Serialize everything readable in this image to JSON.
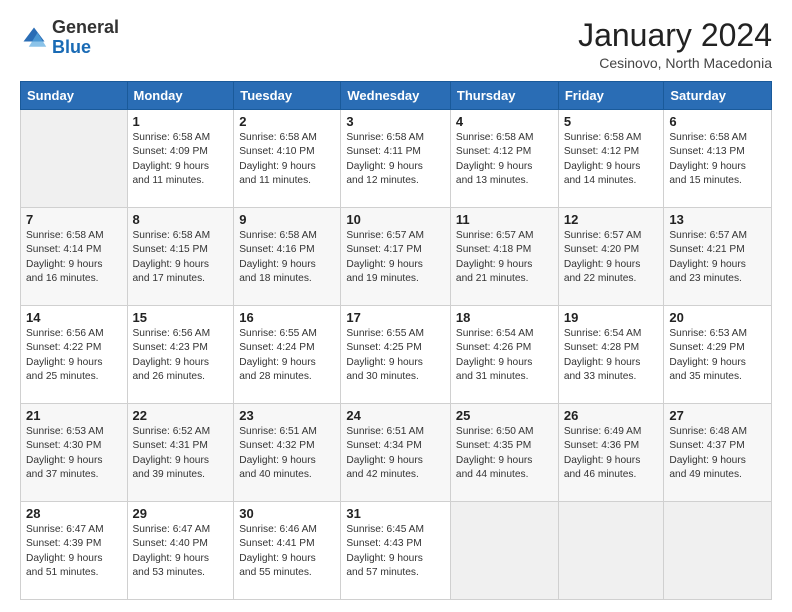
{
  "logo": {
    "general": "General",
    "blue": "Blue"
  },
  "header": {
    "month": "January 2024",
    "location": "Cesinovo, North Macedonia"
  },
  "days_of_week": [
    "Sunday",
    "Monday",
    "Tuesday",
    "Wednesday",
    "Thursday",
    "Friday",
    "Saturday"
  ],
  "weeks": [
    [
      {
        "day": "",
        "info": ""
      },
      {
        "day": "1",
        "info": "Sunrise: 6:58 AM\nSunset: 4:09 PM\nDaylight: 9 hours\nand 11 minutes."
      },
      {
        "day": "2",
        "info": "Sunrise: 6:58 AM\nSunset: 4:10 PM\nDaylight: 9 hours\nand 11 minutes."
      },
      {
        "day": "3",
        "info": "Sunrise: 6:58 AM\nSunset: 4:11 PM\nDaylight: 9 hours\nand 12 minutes."
      },
      {
        "day": "4",
        "info": "Sunrise: 6:58 AM\nSunset: 4:12 PM\nDaylight: 9 hours\nand 13 minutes."
      },
      {
        "day": "5",
        "info": "Sunrise: 6:58 AM\nSunset: 4:12 PM\nDaylight: 9 hours\nand 14 minutes."
      },
      {
        "day": "6",
        "info": "Sunrise: 6:58 AM\nSunset: 4:13 PM\nDaylight: 9 hours\nand 15 minutes."
      }
    ],
    [
      {
        "day": "7",
        "info": "Sunrise: 6:58 AM\nSunset: 4:14 PM\nDaylight: 9 hours\nand 16 minutes."
      },
      {
        "day": "8",
        "info": "Sunrise: 6:58 AM\nSunset: 4:15 PM\nDaylight: 9 hours\nand 17 minutes."
      },
      {
        "day": "9",
        "info": "Sunrise: 6:58 AM\nSunset: 4:16 PM\nDaylight: 9 hours\nand 18 minutes."
      },
      {
        "day": "10",
        "info": "Sunrise: 6:57 AM\nSunset: 4:17 PM\nDaylight: 9 hours\nand 19 minutes."
      },
      {
        "day": "11",
        "info": "Sunrise: 6:57 AM\nSunset: 4:18 PM\nDaylight: 9 hours\nand 21 minutes."
      },
      {
        "day": "12",
        "info": "Sunrise: 6:57 AM\nSunset: 4:20 PM\nDaylight: 9 hours\nand 22 minutes."
      },
      {
        "day": "13",
        "info": "Sunrise: 6:57 AM\nSunset: 4:21 PM\nDaylight: 9 hours\nand 23 minutes."
      }
    ],
    [
      {
        "day": "14",
        "info": "Sunrise: 6:56 AM\nSunset: 4:22 PM\nDaylight: 9 hours\nand 25 minutes."
      },
      {
        "day": "15",
        "info": "Sunrise: 6:56 AM\nSunset: 4:23 PM\nDaylight: 9 hours\nand 26 minutes."
      },
      {
        "day": "16",
        "info": "Sunrise: 6:55 AM\nSunset: 4:24 PM\nDaylight: 9 hours\nand 28 minutes."
      },
      {
        "day": "17",
        "info": "Sunrise: 6:55 AM\nSunset: 4:25 PM\nDaylight: 9 hours\nand 30 minutes."
      },
      {
        "day": "18",
        "info": "Sunrise: 6:54 AM\nSunset: 4:26 PM\nDaylight: 9 hours\nand 31 minutes."
      },
      {
        "day": "19",
        "info": "Sunrise: 6:54 AM\nSunset: 4:28 PM\nDaylight: 9 hours\nand 33 minutes."
      },
      {
        "day": "20",
        "info": "Sunrise: 6:53 AM\nSunset: 4:29 PM\nDaylight: 9 hours\nand 35 minutes."
      }
    ],
    [
      {
        "day": "21",
        "info": "Sunrise: 6:53 AM\nSunset: 4:30 PM\nDaylight: 9 hours\nand 37 minutes."
      },
      {
        "day": "22",
        "info": "Sunrise: 6:52 AM\nSunset: 4:31 PM\nDaylight: 9 hours\nand 39 minutes."
      },
      {
        "day": "23",
        "info": "Sunrise: 6:51 AM\nSunset: 4:32 PM\nDaylight: 9 hours\nand 40 minutes."
      },
      {
        "day": "24",
        "info": "Sunrise: 6:51 AM\nSunset: 4:34 PM\nDaylight: 9 hours\nand 42 minutes."
      },
      {
        "day": "25",
        "info": "Sunrise: 6:50 AM\nSunset: 4:35 PM\nDaylight: 9 hours\nand 44 minutes."
      },
      {
        "day": "26",
        "info": "Sunrise: 6:49 AM\nSunset: 4:36 PM\nDaylight: 9 hours\nand 46 minutes."
      },
      {
        "day": "27",
        "info": "Sunrise: 6:48 AM\nSunset: 4:37 PM\nDaylight: 9 hours\nand 49 minutes."
      }
    ],
    [
      {
        "day": "28",
        "info": "Sunrise: 6:47 AM\nSunset: 4:39 PM\nDaylight: 9 hours\nand 51 minutes."
      },
      {
        "day": "29",
        "info": "Sunrise: 6:47 AM\nSunset: 4:40 PM\nDaylight: 9 hours\nand 53 minutes."
      },
      {
        "day": "30",
        "info": "Sunrise: 6:46 AM\nSunset: 4:41 PM\nDaylight: 9 hours\nand 55 minutes."
      },
      {
        "day": "31",
        "info": "Sunrise: 6:45 AM\nSunset: 4:43 PM\nDaylight: 9 hours\nand 57 minutes."
      },
      {
        "day": "",
        "info": ""
      },
      {
        "day": "",
        "info": ""
      },
      {
        "day": "",
        "info": ""
      }
    ]
  ]
}
